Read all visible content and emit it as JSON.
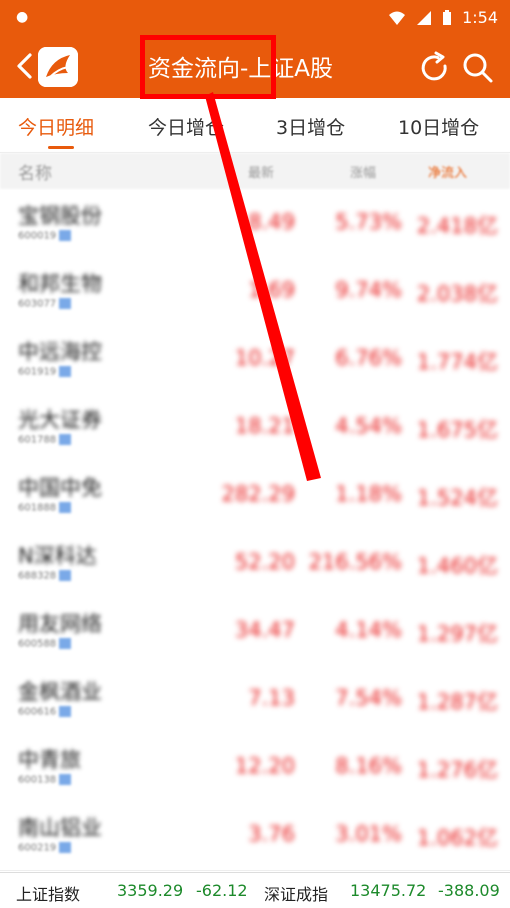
{
  "status_bar": {
    "left_icon": "notification-icon",
    "time": "1:54",
    "icons": [
      "wifi-icon",
      "signal-icon",
      "battery-icon"
    ]
  },
  "header": {
    "title": "资金流向-上证A股",
    "back_icon": "back-arrow-icon",
    "logo_icon": "app-logo-icon",
    "refresh_icon": "refresh-icon",
    "search_icon": "search-icon"
  },
  "tabs": [
    "今日明细",
    "今日增仓",
    "3日增仓",
    "10日增仓"
  ],
  "active_tab": "今日明细",
  "columns": {
    "name": "名称",
    "price": "最新",
    "change": "涨幅",
    "flow": "净流入"
  },
  "rows": [
    {
      "name": "宝钢股份",
      "code": "600019",
      "price": "8.49",
      "change": "5.73%",
      "flow": "2.418亿"
    },
    {
      "name": "和邦生物",
      "code": "603077",
      "price": "1.69",
      "change": "9.74%",
      "flow": "2.038亿"
    },
    {
      "name": "中远海控",
      "code": "601919",
      "price": "10.27",
      "change": "6.76%",
      "flow": "1.774亿"
    },
    {
      "name": "光大证券",
      "code": "601788",
      "price": "18.21",
      "change": "4.54%",
      "flow": "1.675亿"
    },
    {
      "name": "中国中免",
      "code": "601888",
      "price": "282.29",
      "change": "1.18%",
      "flow": "1.524亿"
    },
    {
      "name": "N深科达",
      "code": "688328",
      "price": "52.20",
      "change": "216.56%",
      "flow": "1.460亿"
    },
    {
      "name": "用友网络",
      "code": "600588",
      "price": "34.47",
      "change": "4.14%",
      "flow": "1.297亿"
    },
    {
      "name": "金枫酒业",
      "code": "600616",
      "price": "7.13",
      "change": "7.54%",
      "flow": "1.287亿"
    },
    {
      "name": "中青旅",
      "code": "600138",
      "price": "12.20",
      "change": "8.16%",
      "flow": "1.276亿"
    },
    {
      "name": "南山铝业",
      "code": "600219",
      "price": "3.76",
      "change": "3.01%",
      "flow": "1.062亿"
    }
  ],
  "bottom_bar": {
    "sh_label": "上证指数",
    "sh_value": "3359.29",
    "sh_change": "-62.12",
    "sz_label": "深证成指",
    "sz_value": "13475.72",
    "sz_change": "-388.09"
  },
  "colors": {
    "brand": "#e85a0c",
    "up": "#e81b1b",
    "down": "#1d8a2b",
    "annotation": "#ff0000"
  }
}
